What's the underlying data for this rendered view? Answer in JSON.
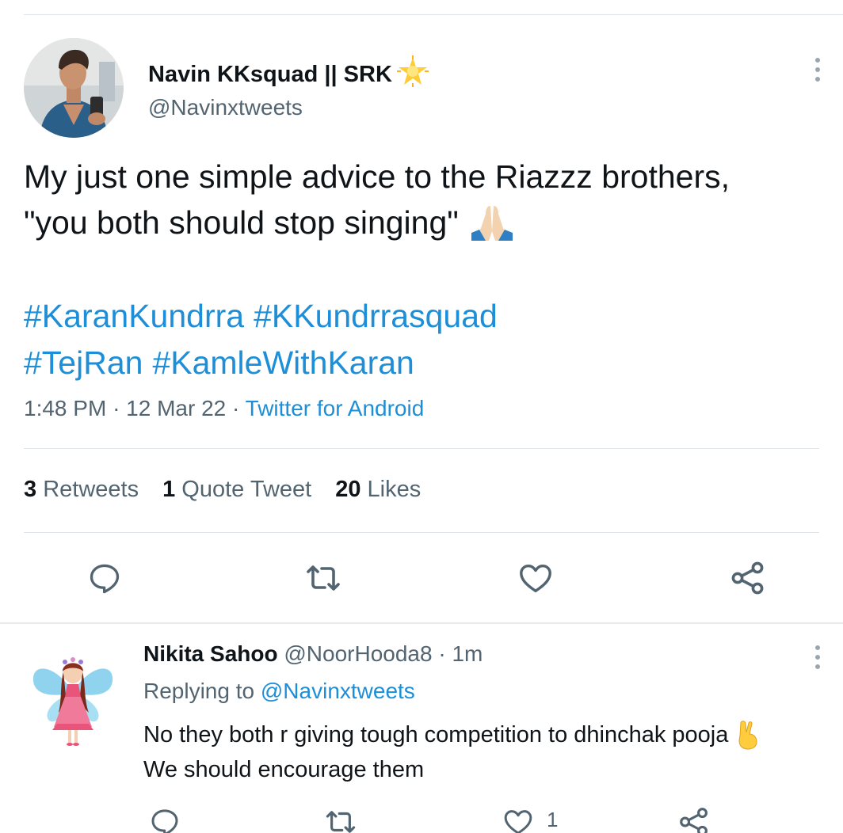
{
  "tweet": {
    "display_name": "Navin KKsquad || SRK",
    "name_emoji": "star-emoji",
    "handle": "@Navinxtweets",
    "text_line1": "My just one simple advice to the Riazzz brothers,",
    "text_line2": "\"you both should stop singing\"",
    "text_emoji": "folded-hands-emoji",
    "hashtags_line1": [
      "#KaranKundrra",
      "#KKundrrasquad"
    ],
    "hashtags_line2": [
      "#TejRan",
      "#KamleWithKaran"
    ],
    "time": "1:48 PM",
    "date": "12 Mar 22",
    "source": "Twitter for Android",
    "sep": "·"
  },
  "stats": {
    "retweets_count": "3",
    "retweets_label": "Retweets",
    "quotes_count": "1",
    "quotes_label": "Quote Tweet",
    "likes_count": "20",
    "likes_label": "Likes"
  },
  "actions": [
    "reply-icon",
    "retweet-icon",
    "like-icon",
    "share-icon"
  ],
  "reply": {
    "name": "Nikita Sahoo",
    "handle": "@NoorHooda8",
    "time": "1m",
    "sep": "·",
    "replying_prefix": "Replying to",
    "replying_to": "@Navinxtweets",
    "text_line1": "No they both r giving tough competition to dhinchak pooja",
    "text_emoji": "victory-hand-emoji",
    "text_line2": "We should encourage them",
    "like_count": "1"
  },
  "colors": {
    "link": "#1d8ed8",
    "secondary_text": "#536471",
    "primary_text": "#0f1419",
    "icon": "#536471"
  }
}
